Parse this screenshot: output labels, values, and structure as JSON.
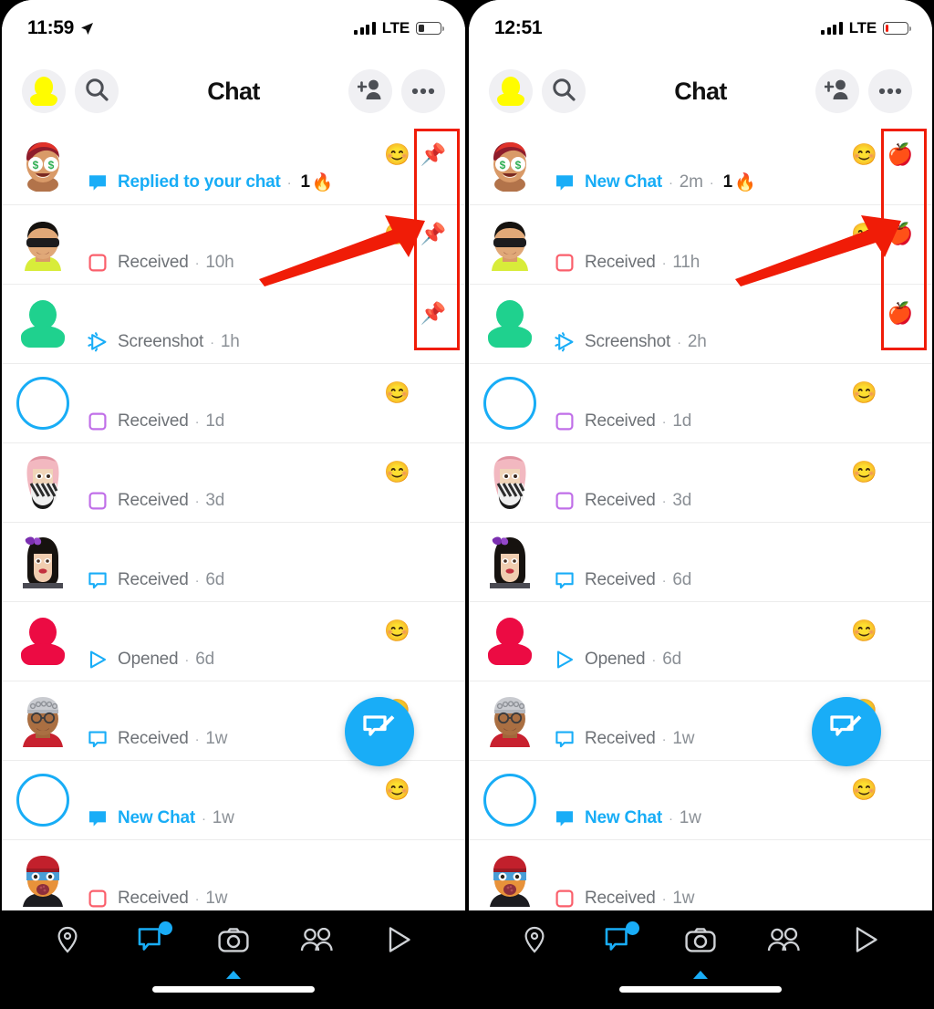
{
  "meta": {
    "accent_blue": "#19adf7",
    "annotation_red": "#f01c07",
    "snapchat_yellow": "#FFFC00",
    "muted_text": "#6e7277"
  },
  "panels": [
    {
      "id": "left",
      "status_bar": {
        "time": "11:59",
        "location_icon": "location-arrow-icon",
        "signal_icon": "cellular-bars-icon",
        "network": "LTE",
        "battery_icon": "battery-icon",
        "battery_fill_percent": 28,
        "battery_color": "#2b2b2b"
      },
      "header": {
        "profile_icon": "bitmoji-avatar-icon",
        "search_icon": "search-icon",
        "title": "Chat",
        "add_friend_icon": "add-friend-icon",
        "more_icon": "more-options-icon"
      },
      "rows": [
        {
          "avatar": "bitmoji-money-eyes",
          "avatar_kind": "bitmoji",
          "status_icon": "chat-bubble-filled",
          "status_color": "#19adf7",
          "lead": "Replied to your chat",
          "lead_highlight": true,
          "time": "",
          "streak": "1",
          "streak_emoji": "🔥",
          "reaction": "😊",
          "pin": "📌"
        },
        {
          "avatar": "bitmoji-sunglasses",
          "avatar_kind": "bitmoji",
          "status_icon": "snap-square-outline",
          "status_color": "#fa5f6b",
          "lead": "Received",
          "lead_highlight": false,
          "time": "10h",
          "streak": "",
          "streak_emoji": "",
          "reaction": "😊",
          "pin": "📌"
        },
        {
          "avatar": "silhouette-green",
          "avatar_kind": "silhouette",
          "avatar_color": "#1fd18e",
          "status_icon": "screenshot-icon",
          "status_color": "#19adf7",
          "lead": "Screenshot",
          "lead_highlight": false,
          "time": "1h",
          "streak": "",
          "streak_emoji": "",
          "reaction": "",
          "pin": "📌"
        },
        {
          "avatar": "empty-ring",
          "avatar_kind": "ring",
          "status_icon": "snap-square-outline",
          "status_color": "#c06fe8",
          "lead": "Received",
          "lead_highlight": false,
          "time": "1d",
          "streak": "",
          "streak_emoji": "",
          "reaction": "😊",
          "pin": ""
        },
        {
          "avatar": "bitmoji-keffiyeh",
          "avatar_kind": "bitmoji",
          "status_icon": "snap-square-outline",
          "status_color": "#c06fe8",
          "lead": "Received",
          "lead_highlight": false,
          "time": "3d",
          "streak": "",
          "streak_emoji": "",
          "reaction": "😊",
          "pin": ""
        },
        {
          "avatar": "bitmoji-bow-girl",
          "avatar_kind": "bitmoji",
          "status_icon": "chat-bubble-outline",
          "status_color": "#19adf7",
          "lead": "Received",
          "lead_highlight": false,
          "time": "6d",
          "streak": "",
          "streak_emoji": "",
          "reaction": "",
          "pin": ""
        },
        {
          "avatar": "silhouette-red",
          "avatar_kind": "silhouette",
          "avatar_color": "#ec0b43",
          "status_icon": "snap-arrow-outline",
          "status_color": "#19adf7",
          "lead": "Opened",
          "lead_highlight": false,
          "time": "6d",
          "streak": "",
          "streak_emoji": "",
          "reaction": "😊",
          "pin": ""
        },
        {
          "avatar": "bitmoji-cap-glasses",
          "avatar_kind": "bitmoji",
          "status_icon": "chat-bubble-outline",
          "status_color": "#19adf7",
          "lead": "Received",
          "lead_highlight": false,
          "time": "1w",
          "streak": "",
          "streak_emoji": "",
          "reaction": "😊",
          "pin": ""
        },
        {
          "avatar": "empty-ring",
          "avatar_kind": "ring",
          "status_icon": "chat-bubble-filled",
          "status_color": "#19adf7",
          "lead": "New Chat",
          "lead_highlight": true,
          "time": "1w",
          "streak": "",
          "streak_emoji": "",
          "reaction": "😊",
          "pin": ""
        },
        {
          "avatar": "bitmoji-beret",
          "avatar_kind": "bitmoji",
          "status_icon": "snap-square-outline",
          "status_color": "#fa5f6b",
          "lead": "Received",
          "lead_highlight": false,
          "time": "1w",
          "streak": "",
          "streak_emoji": "",
          "reaction": "",
          "pin": ""
        }
      ],
      "fab": {
        "icon": "compose-chat-icon"
      },
      "bottom_nav": {
        "items": [
          {
            "icon": "map-pin-icon",
            "active": false,
            "badge": false
          },
          {
            "icon": "chat-bubble-icon",
            "active": true,
            "badge": true
          },
          {
            "icon": "camera-icon",
            "active": false,
            "badge": false
          },
          {
            "icon": "friends-icon",
            "active": false,
            "badge": false
          },
          {
            "icon": "play-spotlight-icon",
            "active": false,
            "badge": false
          }
        ]
      },
      "highlight_box": {
        "label": "pinned-column-highlight"
      }
    },
    {
      "id": "right",
      "status_bar": {
        "time": "12:51",
        "location_icon": "",
        "signal_icon": "cellular-bars-icon",
        "network": "LTE",
        "battery_icon": "battery-icon",
        "battery_fill_percent": 16,
        "battery_color": "#f01c07"
      },
      "header": {
        "profile_icon": "bitmoji-avatar-icon",
        "search_icon": "search-icon",
        "title": "Chat",
        "add_friend_icon": "add-friend-icon",
        "more_icon": "more-options-icon"
      },
      "rows": [
        {
          "avatar": "bitmoji-money-eyes",
          "avatar_kind": "bitmoji",
          "status_icon": "chat-bubble-filled",
          "status_color": "#19adf7",
          "lead": "New Chat",
          "lead_highlight": true,
          "time": "2m",
          "streak": "1",
          "streak_emoji": "🔥",
          "reaction": "😊",
          "pin": "🍎"
        },
        {
          "avatar": "bitmoji-sunglasses",
          "avatar_kind": "bitmoji",
          "status_icon": "snap-square-outline",
          "status_color": "#fa5f6b",
          "lead": "Received",
          "lead_highlight": false,
          "time": "11h",
          "streak": "",
          "streak_emoji": "",
          "reaction": "😊",
          "pin": "🍎"
        },
        {
          "avatar": "silhouette-green",
          "avatar_kind": "silhouette",
          "avatar_color": "#1fd18e",
          "status_icon": "screenshot-icon",
          "status_color": "#19adf7",
          "lead": "Screenshot",
          "lead_highlight": false,
          "time": "2h",
          "streak": "",
          "streak_emoji": "",
          "reaction": "",
          "pin": "🍎"
        },
        {
          "avatar": "empty-ring",
          "avatar_kind": "ring",
          "status_icon": "snap-square-outline",
          "status_color": "#c06fe8",
          "lead": "Received",
          "lead_highlight": false,
          "time": "1d",
          "streak": "",
          "streak_emoji": "",
          "reaction": "😊",
          "pin": ""
        },
        {
          "avatar": "bitmoji-keffiyeh",
          "avatar_kind": "bitmoji",
          "status_icon": "snap-square-outline",
          "status_color": "#c06fe8",
          "lead": "Received",
          "lead_highlight": false,
          "time": "3d",
          "streak": "",
          "streak_emoji": "",
          "reaction": "😊",
          "pin": ""
        },
        {
          "avatar": "bitmoji-bow-girl",
          "avatar_kind": "bitmoji",
          "status_icon": "chat-bubble-outline",
          "status_color": "#19adf7",
          "lead": "Received",
          "lead_highlight": false,
          "time": "6d",
          "streak": "",
          "streak_emoji": "",
          "reaction": "",
          "pin": ""
        },
        {
          "avatar": "silhouette-red",
          "avatar_kind": "silhouette",
          "avatar_color": "#ec0b43",
          "status_icon": "snap-arrow-outline",
          "status_color": "#19adf7",
          "lead": "Opened",
          "lead_highlight": false,
          "time": "6d",
          "streak": "",
          "streak_emoji": "",
          "reaction": "😊",
          "pin": ""
        },
        {
          "avatar": "bitmoji-cap-glasses",
          "avatar_kind": "bitmoji",
          "status_icon": "chat-bubble-outline",
          "status_color": "#19adf7",
          "lead": "Received",
          "lead_highlight": false,
          "time": "1w",
          "streak": "",
          "streak_emoji": "",
          "reaction": "😊",
          "pin": ""
        },
        {
          "avatar": "empty-ring",
          "avatar_kind": "ring",
          "status_icon": "chat-bubble-filled",
          "status_color": "#19adf7",
          "lead": "New Chat",
          "lead_highlight": true,
          "time": "1w",
          "streak": "",
          "streak_emoji": "",
          "reaction": "😊",
          "pin": ""
        },
        {
          "avatar": "bitmoji-beret",
          "avatar_kind": "bitmoji",
          "status_icon": "snap-square-outline",
          "status_color": "#fa5f6b",
          "lead": "Received",
          "lead_highlight": false,
          "time": "1w",
          "streak": "",
          "streak_emoji": "",
          "reaction": "",
          "pin": ""
        }
      ],
      "fab": {
        "icon": "compose-chat-icon"
      },
      "bottom_nav": {
        "items": [
          {
            "icon": "map-pin-icon",
            "active": false,
            "badge": false
          },
          {
            "icon": "chat-bubble-icon",
            "active": true,
            "badge": true
          },
          {
            "icon": "camera-icon",
            "active": false,
            "badge": false
          },
          {
            "icon": "friends-icon",
            "active": false,
            "badge": false
          },
          {
            "icon": "play-spotlight-icon",
            "active": false,
            "badge": false
          }
        ]
      },
      "highlight_box": {
        "label": "pinned-column-highlight"
      }
    }
  ],
  "annotations": [
    {
      "name": "arrow-to-pins-left",
      "type": "arrow"
    },
    {
      "name": "arrow-to-pins-right",
      "type": "arrow"
    }
  ]
}
